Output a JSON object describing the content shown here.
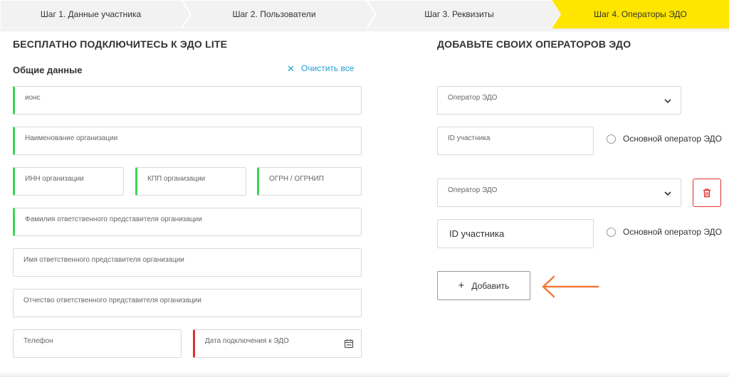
{
  "stepper": {
    "steps": [
      {
        "label": "Шаг 1. Данные участника"
      },
      {
        "label": "Шаг 2. Пользователи"
      },
      {
        "label": "Шаг 3. Реквизиты"
      },
      {
        "label": "Шаг 4. Операторы ЭДО"
      }
    ],
    "active_index": 3,
    "active_color": "#ffe600"
  },
  "left": {
    "title": "БЕСПЛАТНО ПОДКЛЮЧИТЕСЬ К ЭДО LITE",
    "section": "Общие данные",
    "clear_all": "Очистить все",
    "fields": {
      "field1": "ионс",
      "org_name": "Наименование организации",
      "inn": "ИНН организации",
      "kpp": "КПП организации",
      "ogrn": "ОГРН / ОГРНИП",
      "last_name": "Фамилия ответственного представителя организации",
      "first_name": "Имя ответственного представителя организации",
      "patronymic": "Отчество ответственного представителя организации",
      "phone": "Телефон",
      "connect_date": "Дата подключения к ЭДО"
    }
  },
  "right": {
    "title": "ДОБАВЬТЕ СВОИХ ОПЕРАТОРОВ ЭДО",
    "operator_label": "Оператор ЭДО",
    "participant_id": "ID участника",
    "main_operator": "Основной оператор ЭДО",
    "add_button": "Добавить"
  },
  "colors": {
    "valid": "#3bd654",
    "invalid": "#e03131",
    "link": "#1f9fd5",
    "arrow": "#f07a3a"
  },
  "icons": {
    "clear": "close-icon",
    "dropdown": "chevron-down-icon",
    "calendar": "calendar-icon",
    "delete": "trash-icon",
    "add": "plus-icon",
    "annotation": "arrow-left-icon"
  }
}
